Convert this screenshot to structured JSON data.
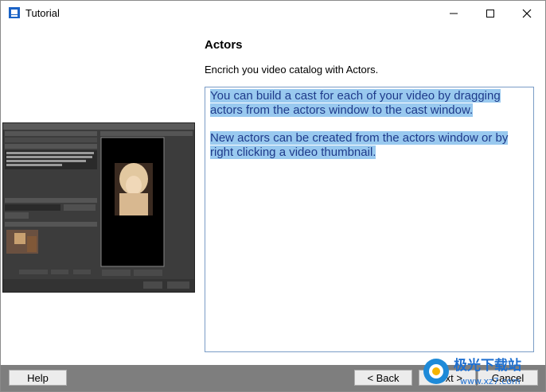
{
  "window": {
    "title": "Tutorial"
  },
  "page": {
    "heading": "Actors",
    "subtitle": "Encrich you video catalog with Actors.",
    "paragraphs": [
      "You can build a cast for each of your video by dragging actors from the actors window to the cast window.",
      "New actors can be created from the actors window or by right clicking a video thumbnail."
    ]
  },
  "footer": {
    "help": "Help",
    "back": "< Back",
    "next": "Next >",
    "cancel": "Cancel"
  },
  "watermark": {
    "cn": "极光下载站",
    "url": "www.xz7.com"
  },
  "colors": {
    "selection": "#99c9ef",
    "footer": "#7e7e7e",
    "accent": "#1e3a8a"
  },
  "icons": [
    "app-icon",
    "minimize-icon",
    "maximize-icon",
    "close-icon"
  ]
}
